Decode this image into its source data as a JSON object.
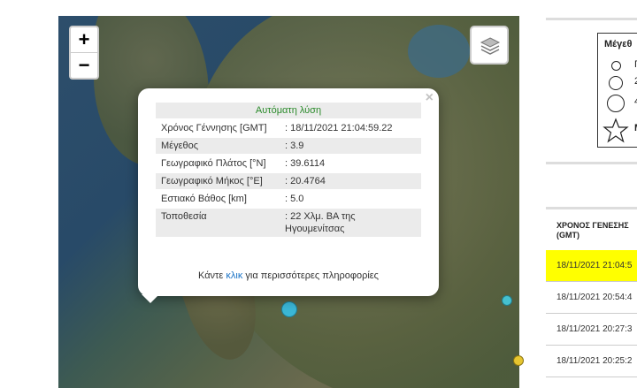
{
  "map": {
    "zoom_in_label": "+",
    "zoom_out_label": "−",
    "layers_icon": "layers-icon",
    "marker_colors": {
      "selected": "#3bb7d6",
      "other": "#45c0cf",
      "yellow": "#e6c52f"
    }
  },
  "popup": {
    "close_label": "×",
    "header": "Αυτόματη λύση",
    "rows": [
      {
        "key": "Χρόνος Γέννησης [GMT]",
        "value": ": 18/11/2021 21:04:59.22"
      },
      {
        "key": "Μέγεθος",
        "value": ": 3.9"
      },
      {
        "key": "Γεωγραφικό Πλάτος [°N]",
        "value": ": 39.6114"
      },
      {
        "key": "Γεωγραφικό Μήκος [°E]",
        "value": ": 20.4764"
      },
      {
        "key": "Εστιακό Βάθος [km]",
        "value": ": 5.0"
      },
      {
        "key": "Τοποθεσία",
        "value": ": 22 Χλμ. ΒΑ της Ηγουμενίτσας"
      }
    ],
    "more_prefix": "Κάντε ",
    "more_link": "κλικ",
    "more_suffix": " για περισσότερες πληροφορίες"
  },
  "legend": {
    "title": "Μέγεθ",
    "items": [
      "Γ",
      "2",
      "4",
      "M"
    ]
  },
  "recent_table": {
    "header_line1": "ΧΡΟΝΟΣ ΓΕΝΕΣΗΣ",
    "header_line2": "(GMT)",
    "rows": [
      "18/11/2021 21:04:5",
      "18/11/2021 20:54:4",
      "18/11/2021 20:27:3",
      "18/11/2021 20:25:2"
    ]
  }
}
